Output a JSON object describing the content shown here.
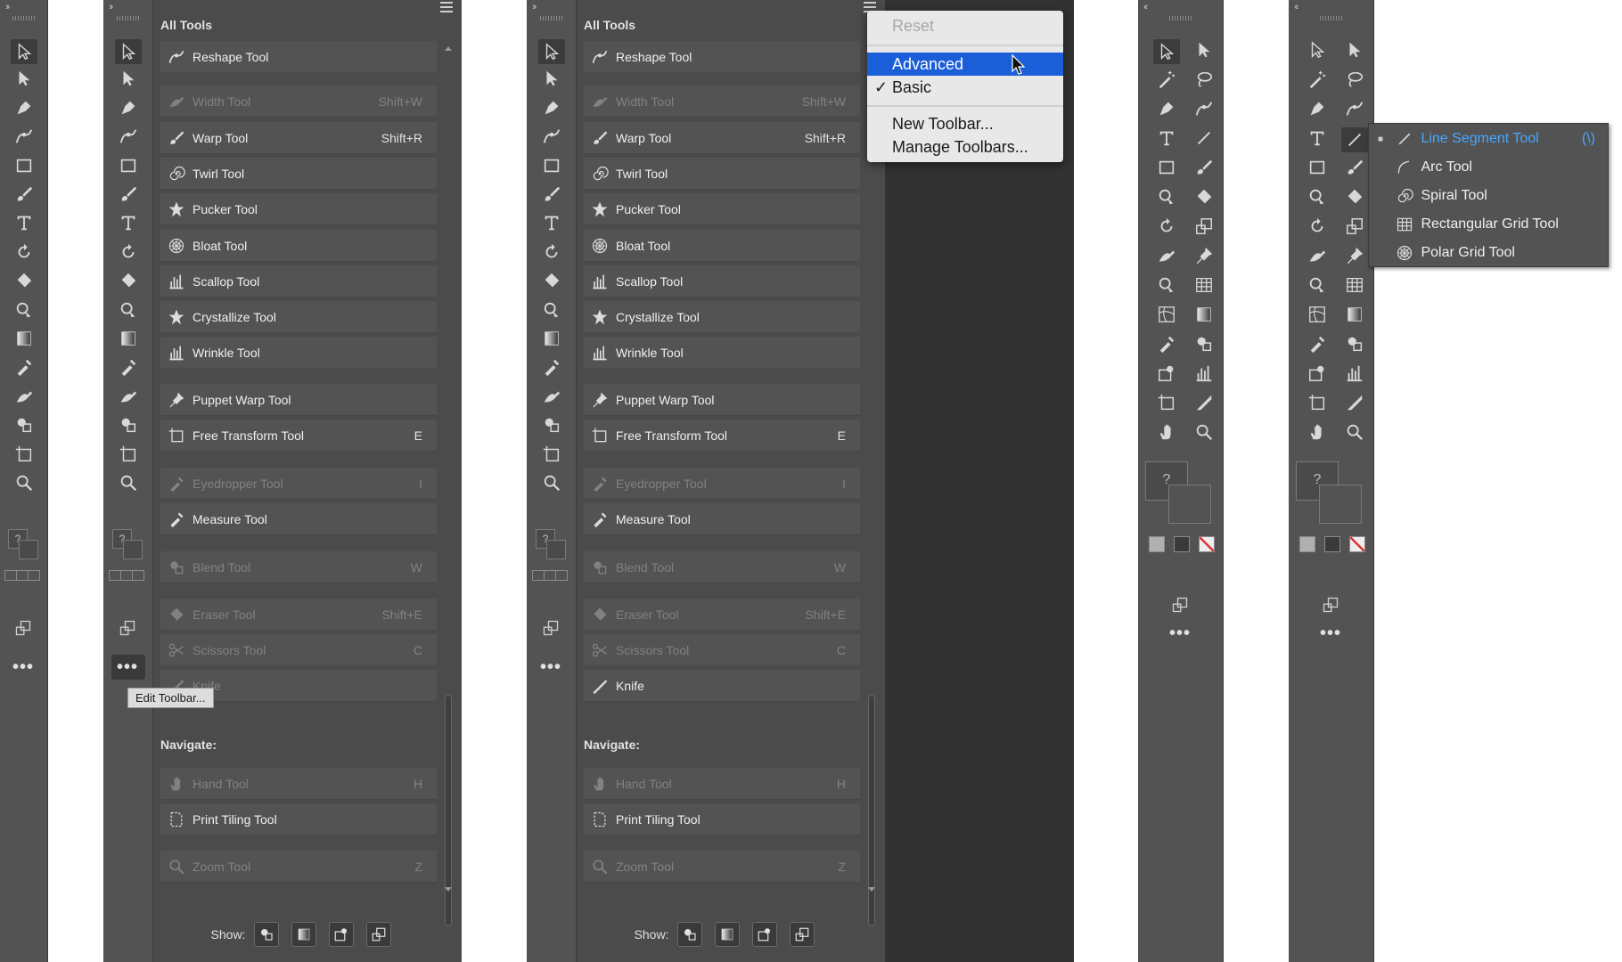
{
  "drawer": {
    "title": "All Tools",
    "rows": [
      {
        "label": "Reshape Tool",
        "key": "",
        "dim": false,
        "icon": "reshape-icon"
      },
      {
        "label": "Width Tool",
        "key": "Shift+W",
        "dim": true,
        "icon": "width-icon"
      },
      {
        "label": "Warp Tool",
        "key": "Shift+R",
        "dim": false,
        "icon": "warp-icon"
      },
      {
        "label": "Twirl Tool",
        "key": "",
        "dim": false,
        "icon": "twirl-icon"
      },
      {
        "label": "Pucker Tool",
        "key": "",
        "dim": false,
        "icon": "pucker-icon"
      },
      {
        "label": "Bloat Tool",
        "key": "",
        "dim": false,
        "icon": "bloat-icon"
      },
      {
        "label": "Scallop Tool",
        "key": "",
        "dim": false,
        "icon": "scallop-icon"
      },
      {
        "label": "Crystallize Tool",
        "key": "",
        "dim": false,
        "icon": "crystallize-icon"
      },
      {
        "label": "Wrinkle Tool",
        "key": "",
        "dim": false,
        "icon": "wrinkle-icon"
      },
      {
        "label": "Puppet Warp Tool",
        "key": "",
        "dim": false,
        "icon": "puppet-warp-icon"
      },
      {
        "label": "Free Transform Tool",
        "key": "E",
        "dim": false,
        "icon": "free-transform-icon"
      },
      {
        "label": "Eyedropper Tool",
        "key": "I",
        "dim": true,
        "icon": "eyedropper-icon"
      },
      {
        "label": "Measure Tool",
        "key": "",
        "dim": false,
        "icon": "measure-icon"
      },
      {
        "label": "Blend Tool",
        "key": "W",
        "dim": true,
        "icon": "blend-icon"
      },
      {
        "label": "Eraser Tool",
        "key": "Shift+E",
        "dim": true,
        "icon": "eraser-icon"
      },
      {
        "label": "Scissors Tool",
        "key": "C",
        "dim": true,
        "icon": "scissors-icon"
      }
    ],
    "knife_a": "Knife",
    "knife_b": "Knife",
    "navigate": "Navigate:",
    "nav_rows": [
      {
        "label": "Hand Tool",
        "key": "H",
        "dim": true
      },
      {
        "label": "Print Tiling Tool",
        "key": "",
        "dim": false
      },
      {
        "label": "Zoom Tool",
        "key": "Z",
        "dim": true
      }
    ],
    "show_label": "Show:"
  },
  "tooltip": "Edit Toolbar...",
  "popup": {
    "reset": "Reset",
    "advanced": "Advanced",
    "basic": "Basic",
    "check": "✓",
    "new_toolbar": "New Toolbar...",
    "manage_toolbars": "Manage Toolbars..."
  },
  "flyout": {
    "items": [
      {
        "label": "Line Segment Tool",
        "key": "(\\)",
        "active": true
      },
      {
        "label": "Arc Tool",
        "key": "",
        "active": false
      },
      {
        "label": "Spiral Tool",
        "key": "",
        "active": false
      },
      {
        "label": "Rectangular Grid Tool",
        "key": "",
        "active": false
      },
      {
        "label": "Polar Grid Tool",
        "key": "",
        "active": false
      }
    ]
  },
  "toolbar": {
    "more_label": "•••",
    "collapse_label": "››",
    "expand_label": "‹‹",
    "color_question": "?"
  },
  "colors": {
    "panel": "#535353",
    "drawer": "#4b4b4b",
    "highlight": "#1a5ed8",
    "active_text": "#4aa6ff",
    "dark_bg": "#323232"
  }
}
